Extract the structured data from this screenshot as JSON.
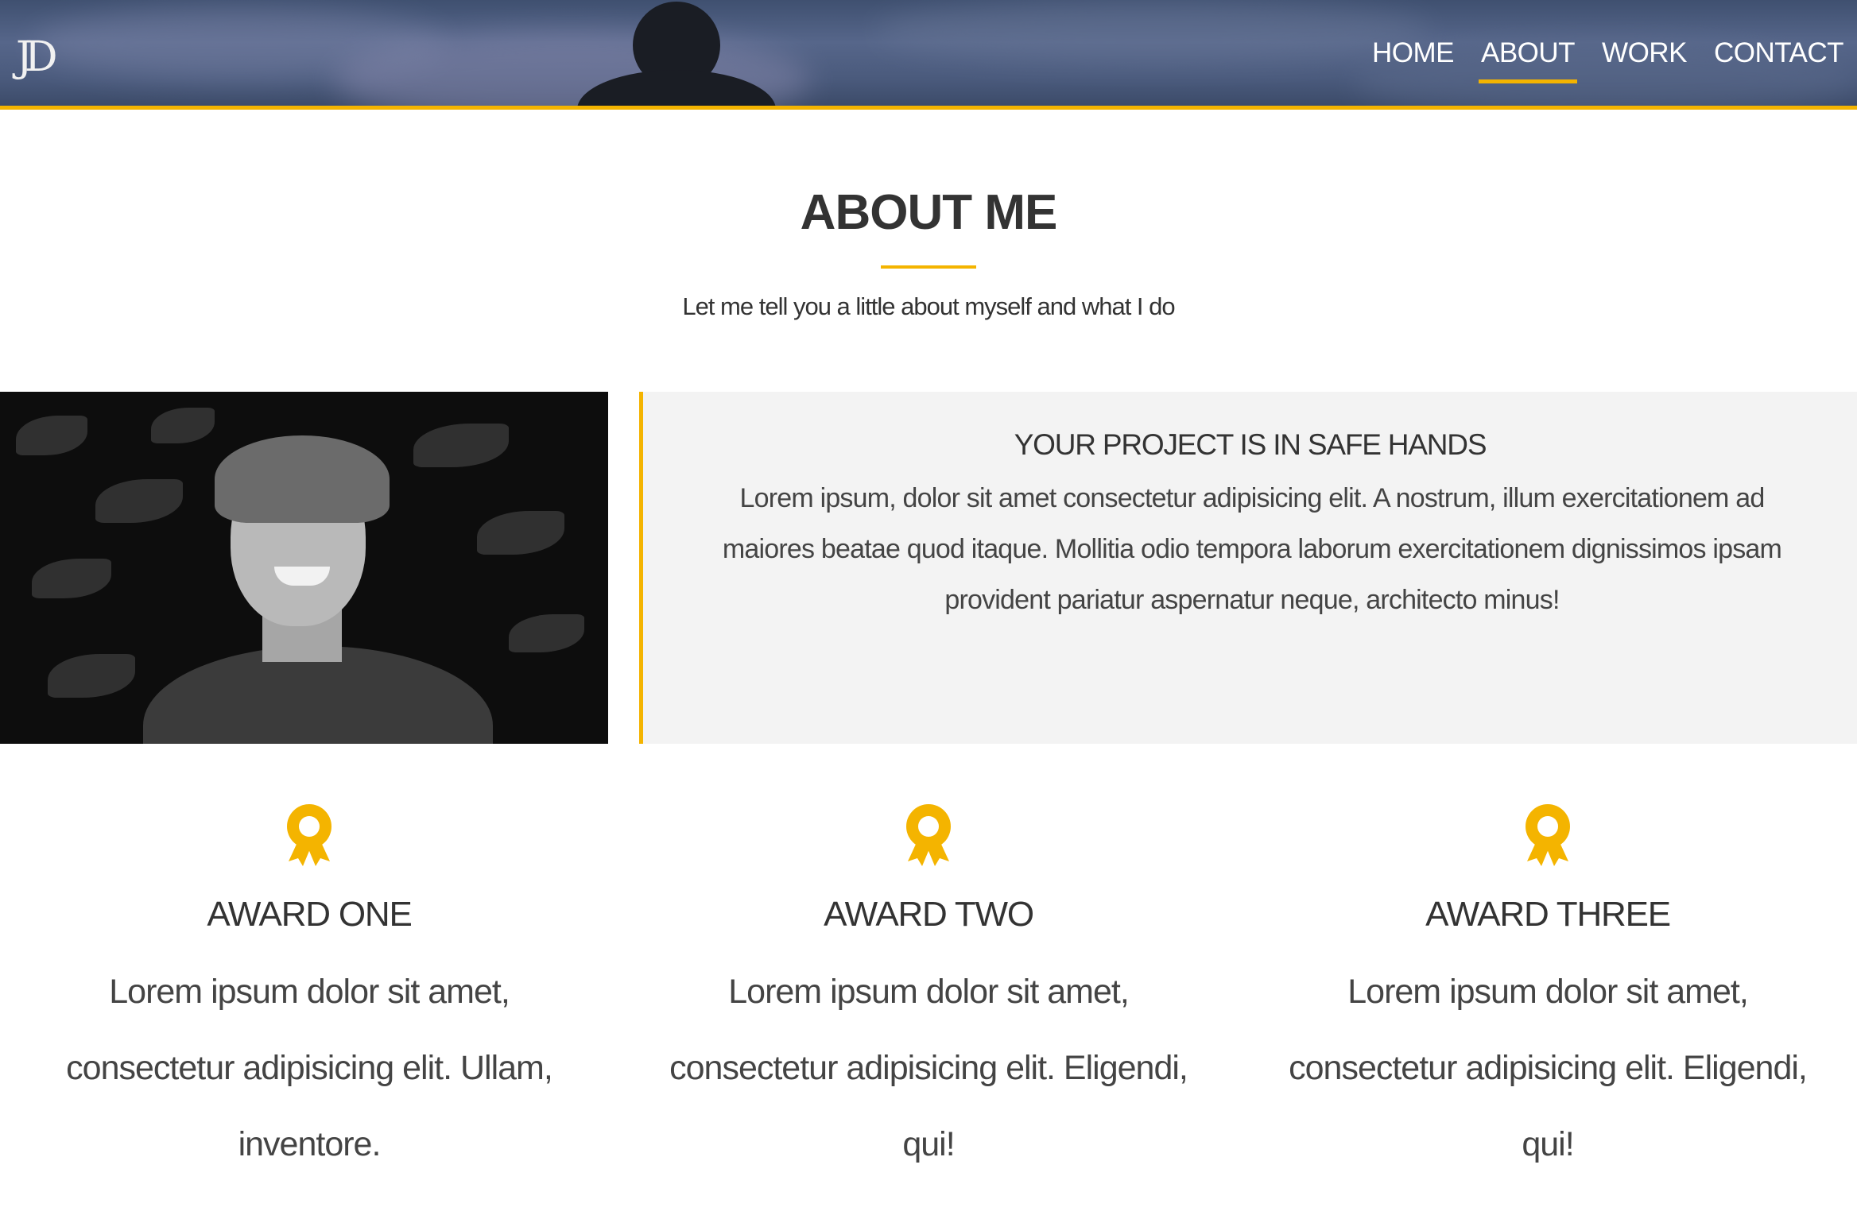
{
  "brand": {
    "logo_text": "JD"
  },
  "nav": {
    "items": [
      {
        "label": "HOME"
      },
      {
        "label": "ABOUT"
      },
      {
        "label": "WORK"
      },
      {
        "label": "CONTACT"
      }
    ],
    "active": "ABOUT"
  },
  "about": {
    "title": "ABOUT ME",
    "subtitle": "Let me tell you a little about myself and what I do"
  },
  "feature": {
    "title": "YOUR PROJECT IS IN SAFE HANDS",
    "text": "Lorem ipsum, dolor sit amet consectetur adipisicing elit. A nostrum, illum exercitationem ad maiores beatae quod itaque. Mollitia odio tempora laborum exercitationem dignissimos ipsam provident pariatur aspernatur neque, architecto minus!"
  },
  "awards": [
    {
      "icon": "award-ribbon-icon",
      "title": "AWARD ONE",
      "text": "Lorem ipsum dolor sit amet, consectetur adipisicing elit. Ullam, inventore."
    },
    {
      "icon": "award-ribbon-icon",
      "title": "AWARD TWO",
      "text": "Lorem ipsum dolor sit amet, consectetur adipisicing elit. Eligendi, qui!"
    },
    {
      "icon": "award-ribbon-icon",
      "title": "AWARD THREE",
      "text": "Lorem ipsum dolor sit amet, consectetur adipisicing elit. Eligendi, qui!"
    }
  ],
  "colors": {
    "accent": "#f4b400",
    "text": "#333333",
    "panel": "#f3f3f3"
  }
}
